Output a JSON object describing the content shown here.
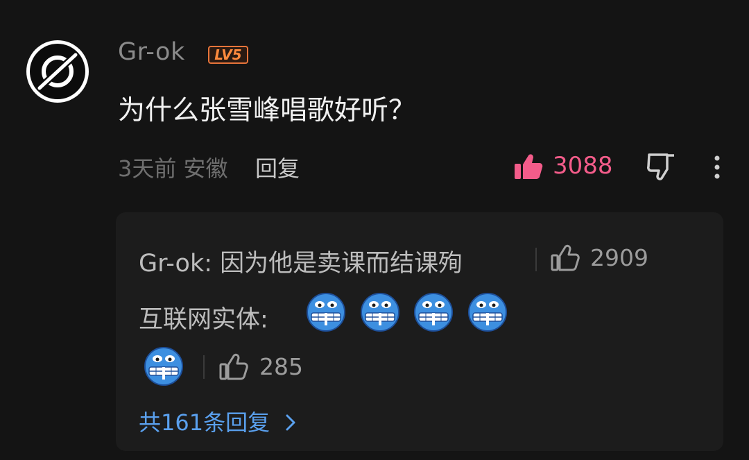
{
  "comment": {
    "username": "Gr-ok",
    "level_badge": "LV5",
    "text": "为什么张雪峰唱歌好听？",
    "time": "3天前",
    "location": "安徽",
    "reply_label": "回复",
    "likes": "3088",
    "accent_like_color": "#f35c8a"
  },
  "replies": [
    {
      "text": "Gr-ok: 因为他是卖课而结课殉",
      "likes": "2909"
    },
    {
      "text": "互联网实体:",
      "emoji_count": 5,
      "emoji_icon": "grimace-blue-face-icon",
      "likes": "285"
    }
  ],
  "more_replies": {
    "label": "共161条回复",
    "color": "#5aa0ee"
  }
}
